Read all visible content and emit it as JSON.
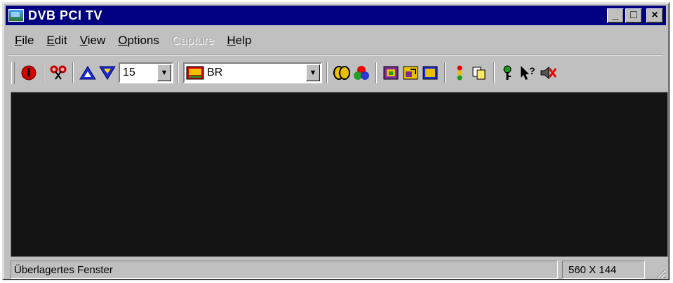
{
  "window": {
    "title": "DVB PCI TV"
  },
  "caption_buttons": {
    "minimize": "_",
    "maximize": "□",
    "close": "×"
  },
  "menu": [
    {
      "label": "File",
      "accel": "F",
      "rest": "ile",
      "enabled": true
    },
    {
      "label": "Edit",
      "accel": "E",
      "rest": "dit",
      "enabled": true
    },
    {
      "label": "View",
      "accel": "V",
      "rest": "iew",
      "enabled": true
    },
    {
      "label": "Options",
      "accel": "O",
      "rest": "ptions",
      "enabled": true
    },
    {
      "label": "Capture",
      "accel": "",
      "rest": "Capture",
      "enabled": false
    },
    {
      "label": "Help",
      "accel": "H",
      "rest": "elp",
      "enabled": true
    }
  ],
  "toolbar": {
    "channel_number": "15",
    "channel_name": "BR",
    "icons": [
      "power-icon",
      "scissors-icon",
      "channel-up-icon",
      "channel-down-icon",
      "tv-station-icon",
      "audio-icon",
      "color-icon",
      "snapshot-icon",
      "resize-icon",
      "fullscreen-icon",
      "traffic-light-icon",
      "copy-icon",
      "key-icon",
      "help-pointer-icon",
      "mute-icon"
    ]
  },
  "status": {
    "text": "Überlagertes Fenster",
    "size": "560 X 144"
  }
}
